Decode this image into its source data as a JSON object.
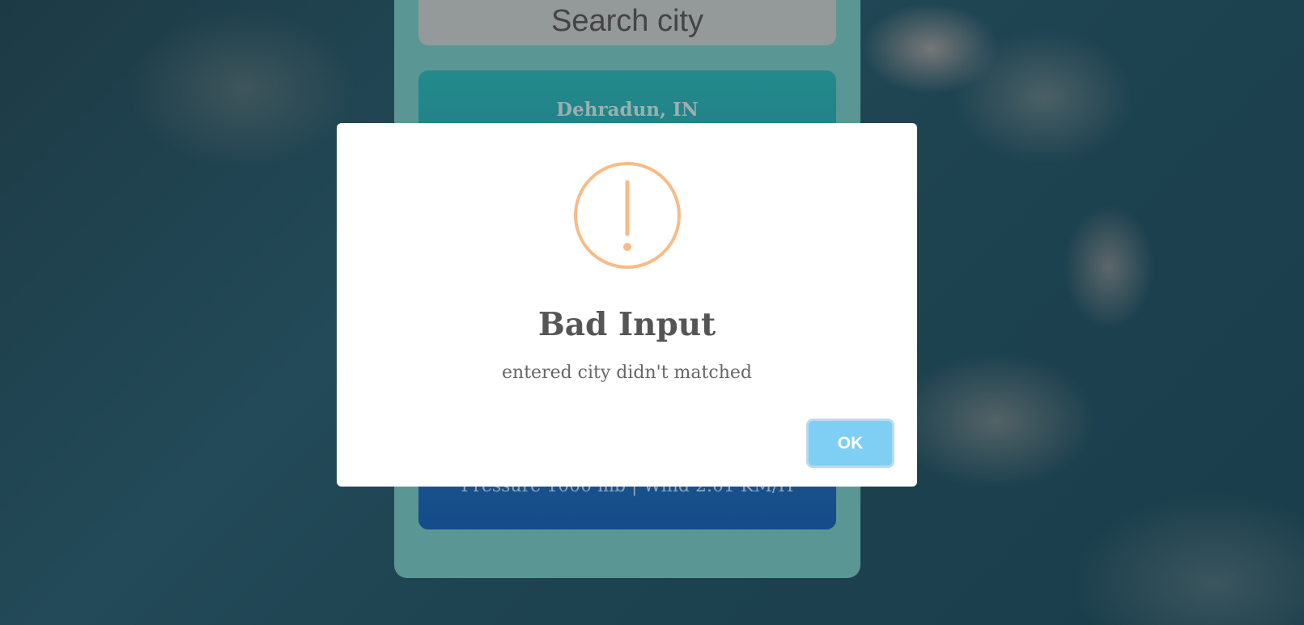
{
  "search": {
    "placeholder": "Search city"
  },
  "weather": {
    "city": "Dehradun, IN",
    "stats": "Pressure 1000 mb | Wind 2.01 KM/H"
  },
  "dialog": {
    "icon": "warning-icon",
    "icon_color": "#f8bb86",
    "title": "Bad Input",
    "message": "entered city didn't matched",
    "ok_label": "OK",
    "ok_color": "#7ecff3"
  }
}
